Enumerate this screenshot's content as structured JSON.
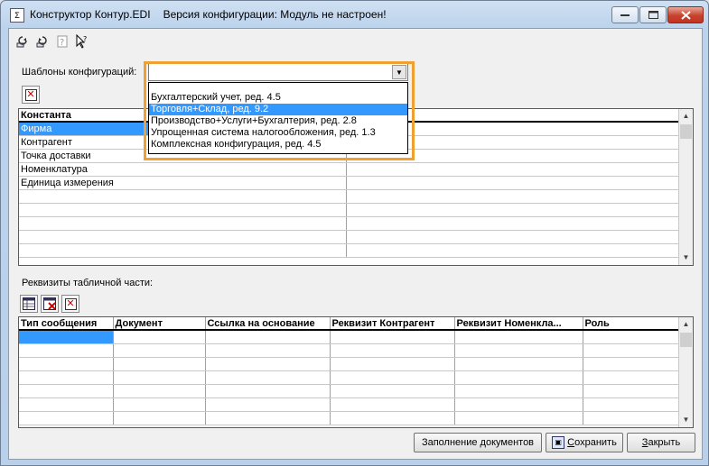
{
  "window": {
    "title": "Конструктор Контур.EDI",
    "config_version": "Версия конфигурации: Модуль не настроен!"
  },
  "templates": {
    "label": "Шаблоны конфигураций:",
    "selected": "",
    "options": [
      "Бухгалтерский учет, ред. 4.5",
      "Торговля+Склад, ред. 9.2",
      "Производство+Услуги+Бухгалтерия, ред. 2.8",
      "Упрощенная система налогообложения, ред. 1.3",
      "Комплексная конфигурация, ред. 4.5"
    ],
    "highlighted_index": 1
  },
  "constants": {
    "header": "Константа",
    "rows": [
      "Фирма",
      "Контрагент",
      "Точка доставки",
      "Номенклатура",
      "Единица измерения",
      "",
      "",
      "",
      "",
      ""
    ]
  },
  "tabular": {
    "label": "Реквизиты табличной части:",
    "headers": [
      "Тип сообщения",
      "Документ",
      "Ссылка на основание",
      "Реквизит Контрагент",
      "Реквизит Номенкла...",
      "Роль"
    ],
    "row_count": 6
  },
  "buttons": {
    "fill_docs": "Заполнение документов",
    "save_prefix": "",
    "save_underlined": "С",
    "save_rest": "охранить",
    "close_underlined": "З",
    "close_rest": "акрыть"
  },
  "colors": {
    "selection": "#3399ff",
    "highlight_frame": "#f0a030"
  }
}
